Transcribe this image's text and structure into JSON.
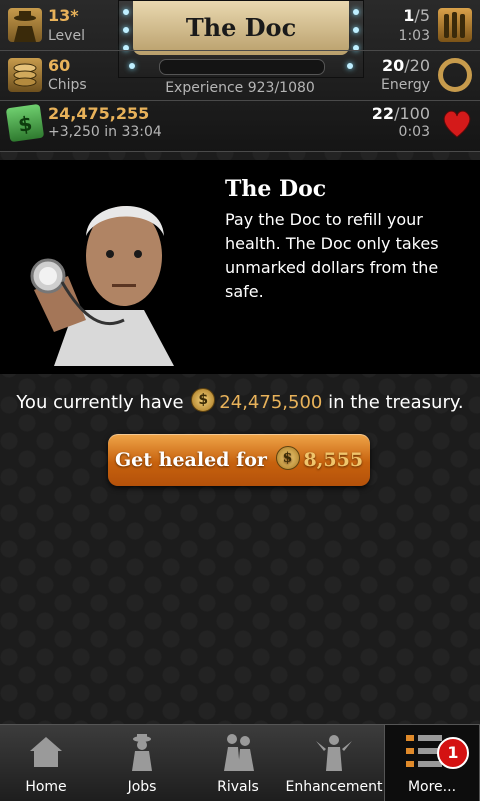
{
  "header": {
    "title": "The Doc",
    "level": {
      "value": "13*",
      "label": "Level"
    },
    "chips": {
      "value": "60",
      "label": "Chips"
    },
    "cash": {
      "value": "24,475,255",
      "sub": "+3,250  in  33:04"
    },
    "ammo": {
      "current": "1",
      "sep_max": "/5",
      "timer": "1:03"
    },
    "energy": {
      "current": "20",
      "sep_max": "/20",
      "label": "Energy"
    },
    "health": {
      "current": "22",
      "sep_max": "/100",
      "timer": "0:03"
    },
    "experience": {
      "label": "Experience 923/1080",
      "current": 923,
      "max": 1080
    }
  },
  "doc": {
    "title": "The Doc",
    "description": "Pay the Doc to refill your health. The Doc only takes unmarked dollars from the safe."
  },
  "treasury": {
    "prefix": "You currently have",
    "amount": "24,475,500",
    "suffix": "in the treasury."
  },
  "heal_button": {
    "label": "Get healed for",
    "price": "8,555"
  },
  "nav": {
    "items": [
      {
        "label": "Home",
        "icon": "home-icon"
      },
      {
        "label": "Jobs",
        "icon": "jobs-icon"
      },
      {
        "label": "Rivals",
        "icon": "rivals-icon"
      },
      {
        "label": "Enhancement",
        "icon": "enhancement-icon"
      },
      {
        "label": "More...",
        "icon": "more-icon",
        "badge": "1"
      }
    ]
  },
  "colors": {
    "gold": "#e8b25a",
    "button_orange": "#d97a1e",
    "badge_red": "#d41212"
  }
}
